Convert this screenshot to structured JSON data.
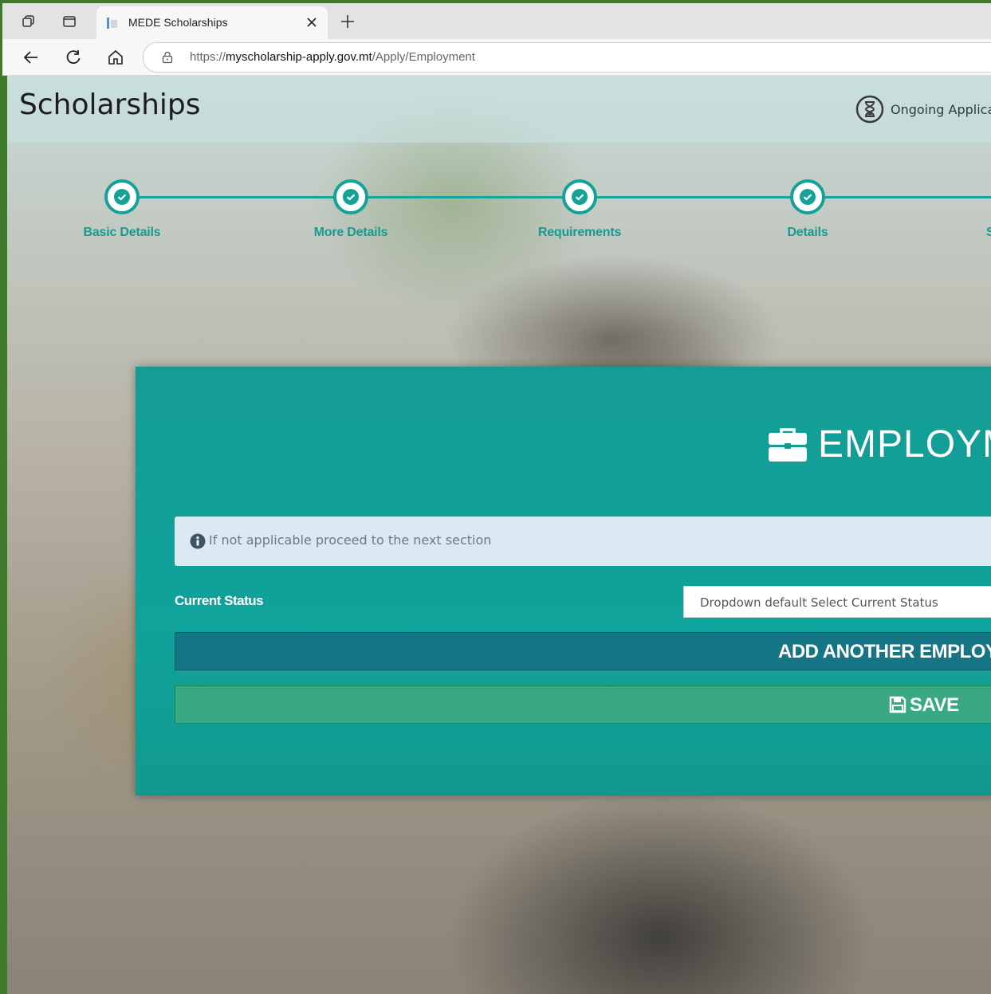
{
  "browser": {
    "tab_title": "MEDE Scholarships",
    "url_scheme": "https://",
    "url_host": "myscholarship-apply.gov.mt",
    "url_path": "/Apply/Employment"
  },
  "header": {
    "title": "Scholarships",
    "ongoing_label": "Ongoing Applicat"
  },
  "steps": [
    {
      "label": "Basic Details",
      "completed": true
    },
    {
      "label": "More Details",
      "completed": true
    },
    {
      "label": "Requirements",
      "completed": true
    },
    {
      "label": "Details",
      "completed": true
    },
    {
      "label": "S",
      "completed": true
    }
  ],
  "form": {
    "title": "EMPLOYM",
    "info_text": "If not applicable proceed to the next section",
    "current_status_label": "Current Status",
    "current_status_value": "Dropdown default Select Current Status",
    "add_button": "ADD ANOTHER EMPLOY",
    "save_button": "SAVE"
  },
  "colors": {
    "accent": "#14a197",
    "card": "#0fa39b",
    "add_button": "#167584",
    "save_button": "#3aa884"
  }
}
